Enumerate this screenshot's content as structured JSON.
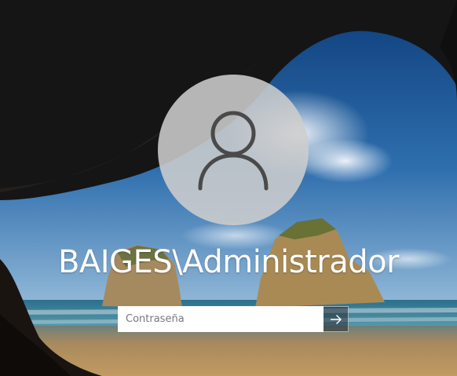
{
  "lock_screen": {
    "user": {
      "avatar_icon": "person-icon",
      "name": "BAIGES\\Administrador"
    },
    "password": {
      "placeholder": "Contraseña",
      "value": ""
    },
    "submit": {
      "icon": "arrow-right-icon"
    }
  },
  "colors": {
    "text": "#ffffff",
    "avatar_bg": "#cdcdcd",
    "avatar_glyph": "#4a4a4a",
    "input_bg": "#ffffff",
    "sky": "#1f5f9e",
    "sea": "#2f7f98",
    "sand": "#b8925c",
    "cave": "#141414"
  }
}
